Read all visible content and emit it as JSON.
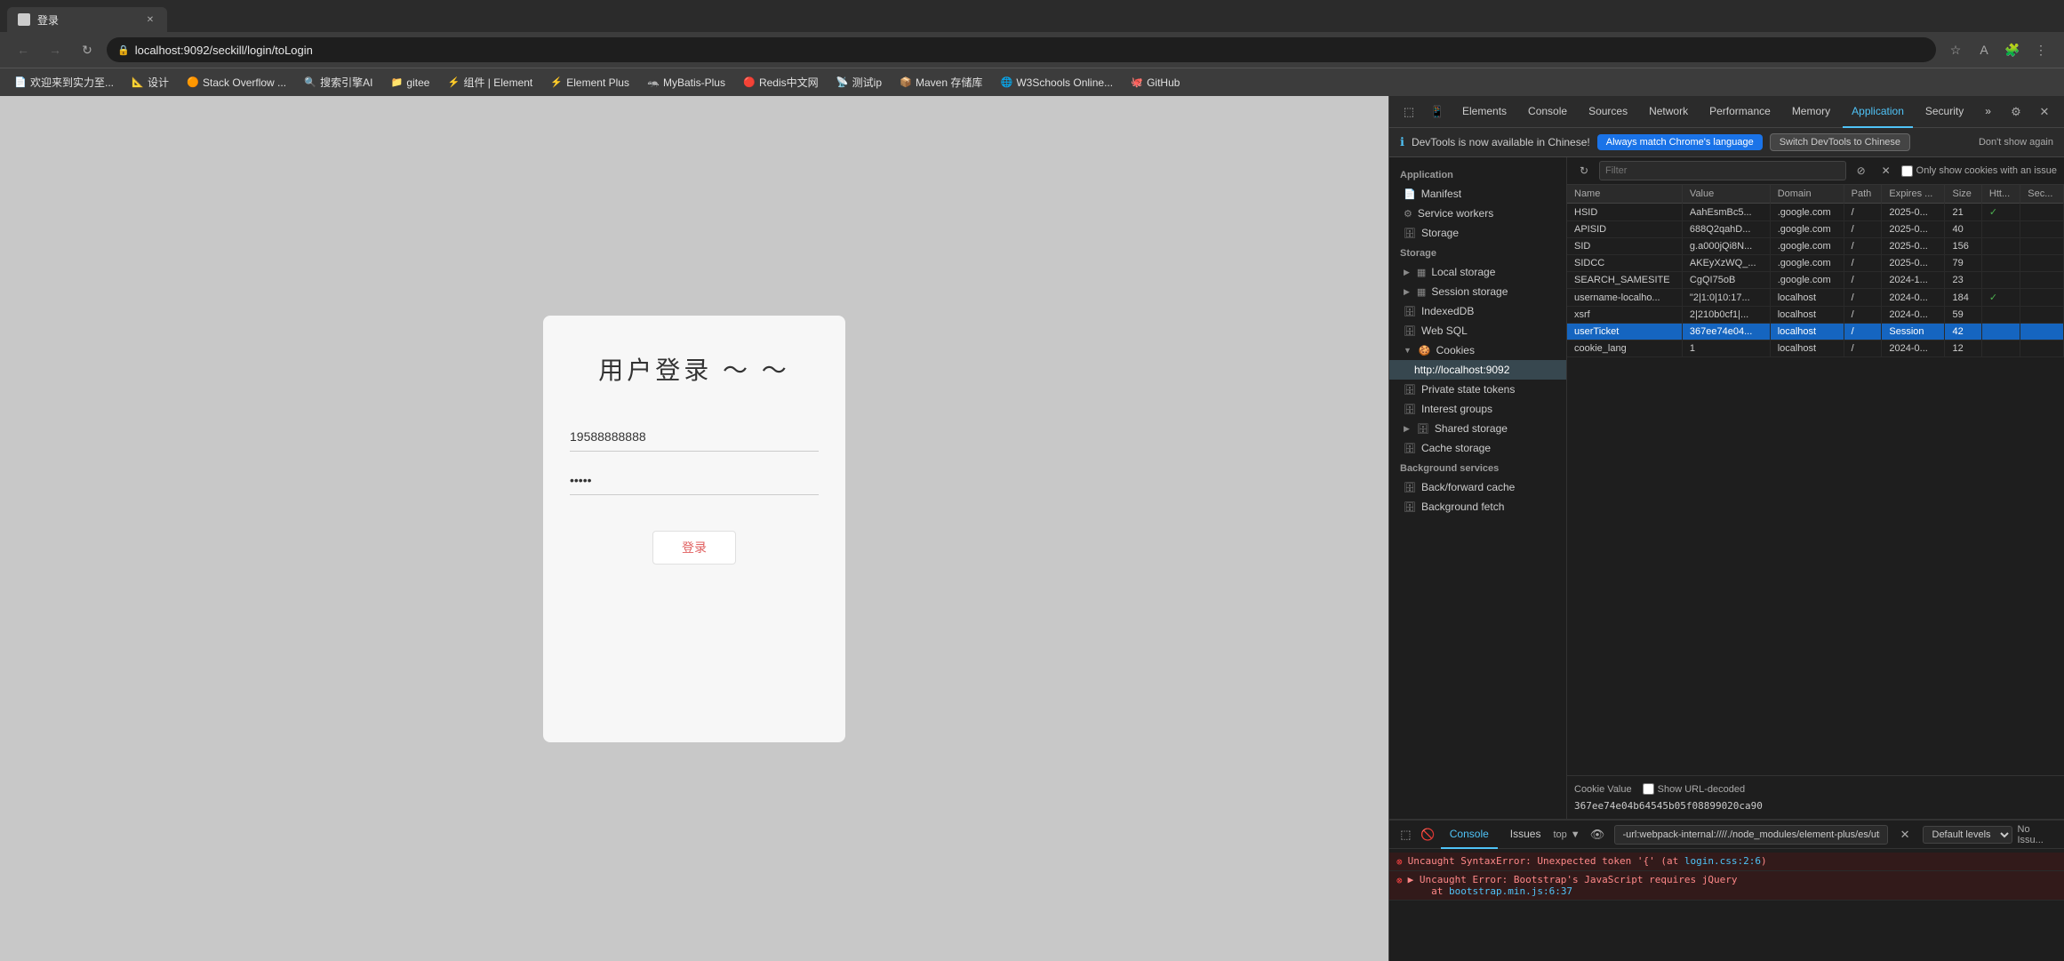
{
  "browser": {
    "tab_title": "登录",
    "url": "localhost:9092/seckill/login/toLogin",
    "nav": {
      "back_disabled": true,
      "forward_disabled": true
    },
    "bookmarks": [
      {
        "label": "欢迎来到实力至...",
        "icon": "📄"
      },
      {
        "label": "设计",
        "icon": "📐"
      },
      {
        "label": "Stack Overflow ...",
        "icon": "🟠"
      },
      {
        "label": "搜索引擎AI",
        "icon": "🔍"
      },
      {
        "label": "gitee",
        "icon": "📁"
      },
      {
        "label": "组件 | Element",
        "icon": "⚡"
      },
      {
        "label": "Element Plus",
        "icon": "⚡"
      },
      {
        "label": "MyBatis-Plus",
        "icon": "🦡"
      },
      {
        "label": "Redis中文网",
        "icon": "🔴"
      },
      {
        "label": "测试ip",
        "icon": "📡"
      },
      {
        "label": "Maven 存储库",
        "icon": "📦"
      },
      {
        "label": "W3Schools Online...",
        "icon": "🌐"
      },
      {
        "label": "GitHub",
        "icon": "🐙"
      }
    ]
  },
  "login_page": {
    "title": "用户登录 ～ ～",
    "phone_value": "19588888888",
    "password_value": "•••••",
    "button_label": "登录"
  },
  "devtools": {
    "tabs": [
      "Elements",
      "Console",
      "Sources",
      "Network",
      "Performance",
      "Memory",
      "Application",
      "Security",
      "»"
    ],
    "active_tab": "Application",
    "notification": {
      "icon": "ℹ",
      "text": "DevTools is now available in Chinese!",
      "btn1": "Always match Chrome's language",
      "btn2": "Switch DevTools to Chinese",
      "dismiss": "Don't show again"
    },
    "sidebar": {
      "sections": [
        {
          "title": "Application",
          "items": [
            {
              "label": "Manifest",
              "icon": "📄",
              "indent": 0
            },
            {
              "label": "Service workers",
              "icon": "⚙",
              "indent": 0
            },
            {
              "label": "Storage",
              "icon": "🗄",
              "indent": 0
            }
          ]
        },
        {
          "title": "Storage",
          "items": [
            {
              "label": "Local storage",
              "icon": "▦",
              "indent": 0,
              "expandable": true
            },
            {
              "label": "Session storage",
              "icon": "▦",
              "indent": 0,
              "expandable": true
            },
            {
              "label": "IndexedDB",
              "icon": "🗄",
              "indent": 0
            },
            {
              "label": "Web SQL",
              "icon": "🗄",
              "indent": 0
            },
            {
              "label": "Cookies",
              "icon": "🍪",
              "indent": 0,
              "expandable": true,
              "expanded": true
            },
            {
              "label": "http://localhost:9092",
              "icon": "",
              "indent": 1,
              "active": true
            },
            {
              "label": "Private state tokens",
              "icon": "🗄",
              "indent": 0
            },
            {
              "label": "Interest groups",
              "icon": "🗄",
              "indent": 0
            },
            {
              "label": "Shared storage",
              "icon": "▶",
              "indent": 0,
              "expandable": true
            },
            {
              "label": "Cache storage",
              "icon": "🗄",
              "indent": 0
            }
          ]
        },
        {
          "title": "Background services",
          "items": [
            {
              "label": "Back/forward cache",
              "icon": "🗄",
              "indent": 0
            },
            {
              "label": "Background fetch",
              "icon": "🗄",
              "indent": 0
            }
          ]
        }
      ]
    },
    "cookie_panel": {
      "filter_placeholder": "Filter",
      "only_show_issues_label": "Only show cookies with an issue",
      "columns": [
        "Name",
        "Value",
        "Domain",
        "Path",
        "Expires ...",
        "Size",
        "Htt...",
        "Sec..."
      ],
      "rows": [
        {
          "name": "HSID",
          "value": "AahEsmBc5...",
          "domain": ".google.com",
          "path": "/",
          "expires": "2025-0...",
          "size": "21",
          "http": "✓",
          "secure": ""
        },
        {
          "name": "APISID",
          "value": "688Q2qahD...",
          "domain": ".google.com",
          "path": "/",
          "expires": "2025-0...",
          "size": "40",
          "http": "",
          "secure": ""
        },
        {
          "name": "SID",
          "value": "g.a000jQi8N...",
          "domain": ".google.com",
          "path": "/",
          "expires": "2025-0...",
          "size": "156",
          "http": "",
          "secure": ""
        },
        {
          "name": "SIDCC",
          "value": "AKEyXzWQ_...",
          "domain": ".google.com",
          "path": "/",
          "expires": "2025-0...",
          "size": "79",
          "http": "",
          "secure": ""
        },
        {
          "name": "SEARCH_SAMESITE",
          "value": "CgQI75oB",
          "domain": ".google.com",
          "path": "/",
          "expires": "2024-1...",
          "size": "23",
          "http": "",
          "secure": ""
        },
        {
          "name": "username-localho...",
          "value": "\"2|1:0|10:17...",
          "domain": "localhost",
          "path": "/",
          "expires": "2024-0...",
          "size": "184",
          "http": "✓",
          "secure": ""
        },
        {
          "name": "xsrf",
          "value": "2|210b0cf1|...",
          "domain": "localhost",
          "path": "/",
          "expires": "2024-0...",
          "size": "59",
          "http": "",
          "secure": ""
        },
        {
          "name": "userTicket",
          "value": "367ee74e04...",
          "domain": "localhost",
          "path": "/",
          "expires": "Session",
          "size": "42",
          "http": "",
          "secure": "",
          "selected": true
        },
        {
          "name": "cookie_lang",
          "value": "1",
          "domain": "localhost",
          "path": "/",
          "expires": "2024-0...",
          "size": "12",
          "http": "",
          "secure": ""
        }
      ],
      "cookie_value_label": "Cookie Value",
      "show_url_decoded_label": "Show URL-decoded",
      "cookie_value": "367ee74e04b64545b05f08899020ca90"
    },
    "console": {
      "tabs": [
        "Console",
        "Issues"
      ],
      "active_tab": "Console",
      "source_input": "-url:webpack-internal:////./node_modules/element-plus/es/utils/error.mjs",
      "level_label": "Default levels",
      "top_label": "top",
      "no_issues_label": "No Issu...",
      "messages": [
        {
          "type": "error",
          "text": "Uncaught SyntaxError: Unexpected token '{' (at ",
          "link_text": "login.css:2:6",
          "link_href": "login.css:2:6",
          "suffix": ")"
        },
        {
          "type": "error",
          "text": "▶ Uncaught Error: Bootstrap's JavaScript requires jQuery\n    at bootstrap.min.js:6:37",
          "link_text": "bootst...",
          "link_href": "#",
          "line2": "    at bootstrap.min.js:6:37"
        }
      ]
    }
  }
}
